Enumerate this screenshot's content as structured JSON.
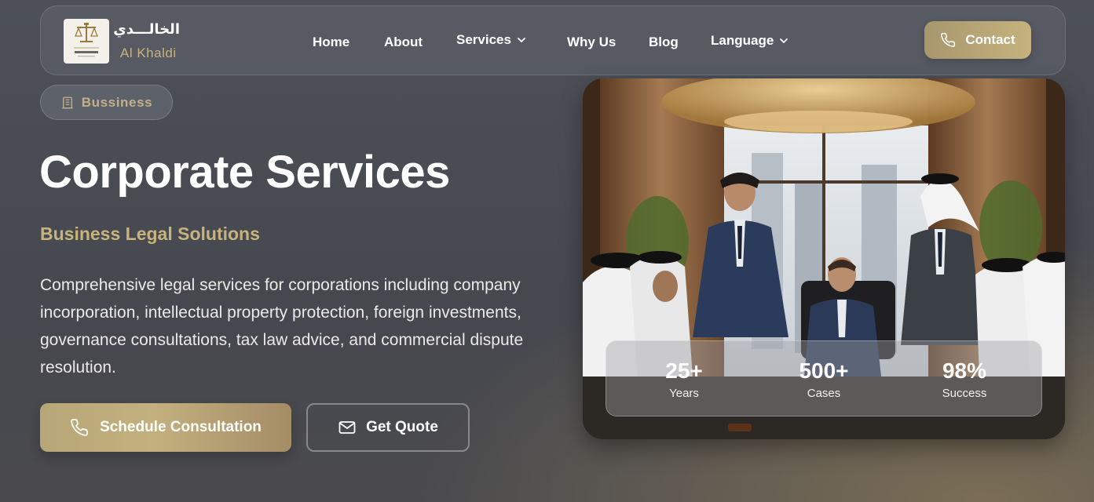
{
  "brand": {
    "name_ar": "الخالـــدي",
    "name_en": "Al Khaldi",
    "logo_text": "AL KHALDI"
  },
  "nav": {
    "home": "Home",
    "about": "About",
    "services": "Services",
    "why_us": "Why Us",
    "blog": "Blog",
    "language": "Language",
    "contact": "Contact"
  },
  "hero": {
    "badge": "Bussiness",
    "title": "Corporate Services",
    "subtitle": "Business Legal Solutions",
    "description": "Comprehensive legal services for corporations including company incorporation, intellectual property protection, foreign investments, governance consultations, tax law advice, and commercial dispute resolution.",
    "cta_primary": "Schedule Consultation",
    "cta_secondary": "Get Quote"
  },
  "stats": [
    {
      "value": "25+",
      "label": "Years"
    },
    {
      "value": "500+",
      "label": "Cases"
    },
    {
      "value": "98%",
      "label": "Success"
    }
  ],
  "icons": {
    "logo": "scales-of-justice-logo",
    "badge": "building-icon",
    "phone": "phone-icon",
    "mail": "mail-icon",
    "chevron": "chevron-down-icon"
  },
  "colors": {
    "accent_gold": "#c5b27e",
    "background": "#4a4c53"
  }
}
